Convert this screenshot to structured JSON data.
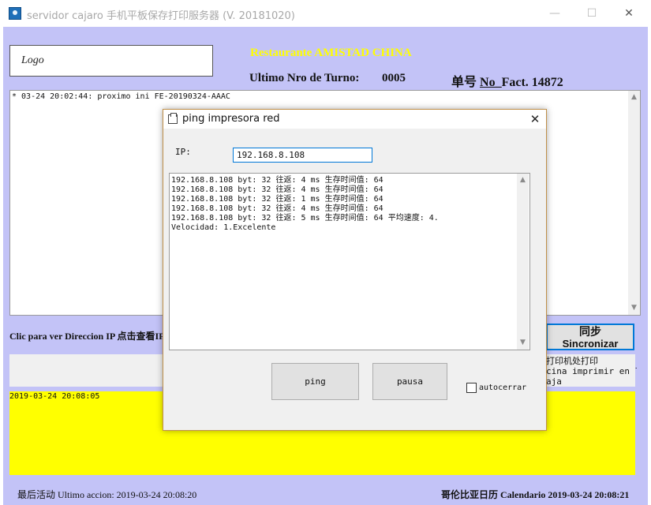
{
  "window": {
    "title": "servidor cajaro 手机平板保存打印服务器 (V. 20181020)",
    "minimize": "—",
    "maximize": "☐",
    "close": "✕"
  },
  "header": {
    "logo": "Logo",
    "restaurant": "Restaurante AMISTAD CHINA",
    "turn_label": "Ultimo Nro de Turno:",
    "turn_value": "0005",
    "fact_prefix": "单号 ",
    "fact_label": "No_",
    "fact_value": "Fact. 14872"
  },
  "log": {
    "line": "* 03-24 20:02:44: proximo ini FE-20190324-AAAC"
  },
  "controls": {
    "ip_link": "Clic para ver Direccion IP 点击查看IP",
    "sync_cn": "同步",
    "sync_es": "Sincronizar",
    "info_line1": "打印机处打印",
    "info_line2": "cina imprimir en la",
    "info_line3": "aja"
  },
  "yellow": {
    "timestamp": "2019-03-24 20:08:05"
  },
  "status": {
    "last_action": "最后活动 Ultimo accion: 2019-03-24 20:08:20",
    "calendar": "哥伦比亚日历 Calendario   2019-03-24 20:08:21"
  },
  "dialog": {
    "title": "ping impresora red",
    "close": "✕",
    "ip_label": "IP:",
    "ip_value": "192.168.8.108",
    "output": [
      "192.168.8.108 byt: 32 往返: 4 ms 生存时间值: 64",
      "192.168.8.108 byt: 32 往返: 4 ms 生存时间值: 64",
      "192.168.8.108 byt: 32 往返: 1 ms 生存时间值: 64",
      "192.168.8.108 byt: 32 往返: 4 ms 生存时间值: 64",
      "192.168.8.108 byt: 32 往返: 5 ms 生存时间值: 64 平均速度: 4.",
      "Velocidad: 1.Excelente"
    ],
    "ping_button": "ping",
    "pause_button": "pausa",
    "autoclose_label": "autocerrar"
  },
  "icons": {
    "up_arrow": "▲",
    "down_arrow": "▼"
  },
  "colors": {
    "client_bg": "#c3c3f7",
    "restaurant_text": "#ffff00",
    "yellow_area": "#ffff00",
    "focus_border": "#0078d7"
  }
}
